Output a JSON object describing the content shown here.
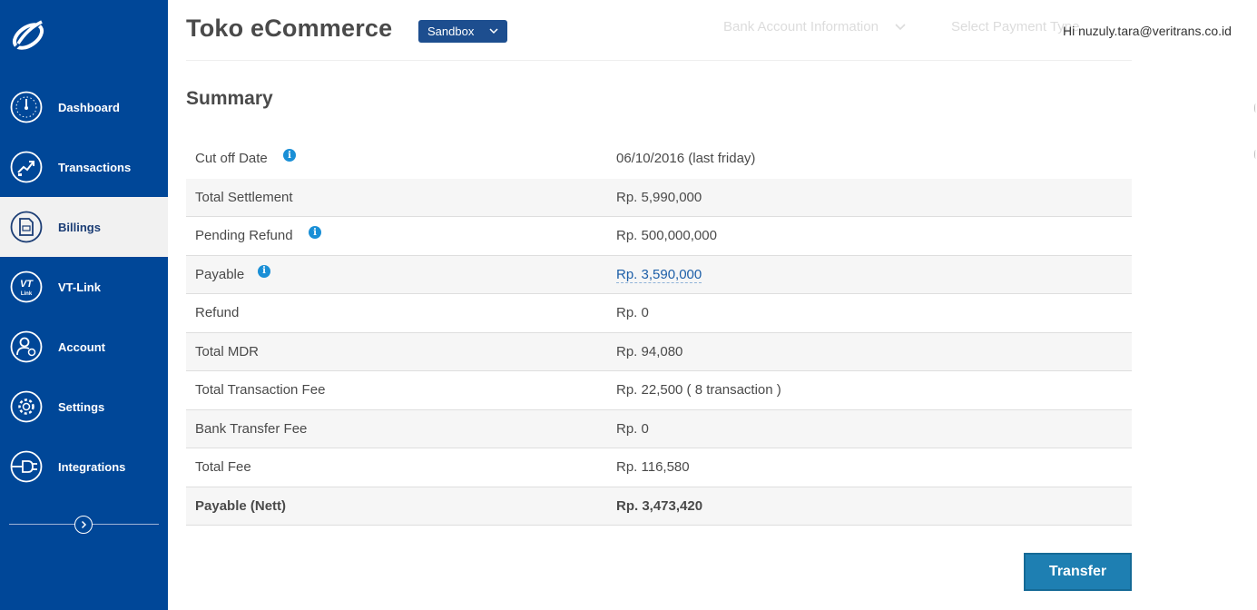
{
  "sidebar": {
    "items": [
      {
        "label": "Dashboard"
      },
      {
        "label": "Transactions"
      },
      {
        "label": "Billings"
      },
      {
        "label": "VT-Link"
      },
      {
        "label": "Account"
      },
      {
        "label": "Settings"
      },
      {
        "label": "Integrations"
      }
    ],
    "active_item": "Billings"
  },
  "header": {
    "store_name": "Toko eCommerce",
    "environment": "Sandbox",
    "ghost_step_1": "Bank Account Information",
    "ghost_step_2": "Select Payment Type",
    "greeting": "Hi nuzuly.tara@veritrans.co.id"
  },
  "summary": {
    "title": "Summary",
    "rows": [
      {
        "label": "Cut off Date",
        "value": "06/10/2016 (last friday)"
      },
      {
        "label": "Total Settlement",
        "value": "Rp. 5,990,000"
      },
      {
        "label": "Pending Refund",
        "value": "Rp. 500,000,000"
      },
      {
        "label": "Payable",
        "value": "Rp. 3,590,000"
      },
      {
        "label": "Refund",
        "value": "Rp. 0"
      },
      {
        "label": "Total MDR",
        "value": "Rp. 94,080"
      },
      {
        "label": "Total Transaction Fee",
        "value": "Rp. 22,500 ( 8 transaction )"
      },
      {
        "label": "Bank Transfer Fee",
        "value": "Rp. 0"
      },
      {
        "label": "Total Fee",
        "value": "Rp. 116,580"
      },
      {
        "label": "Payable (Nett)",
        "value": "Rp. 3,473,420"
      }
    ],
    "info_glyph": "i"
  },
  "actions": {
    "transfer_label": "Transfer"
  },
  "colors": {
    "sidebar_bg": "#004798",
    "active_item_bg": "#f1f1f1",
    "primary_button": "#1e7fb2",
    "env_select_bg": "#1d4e8f",
    "info_icon": "#1a8fd6",
    "link": "#1d5fa8"
  }
}
